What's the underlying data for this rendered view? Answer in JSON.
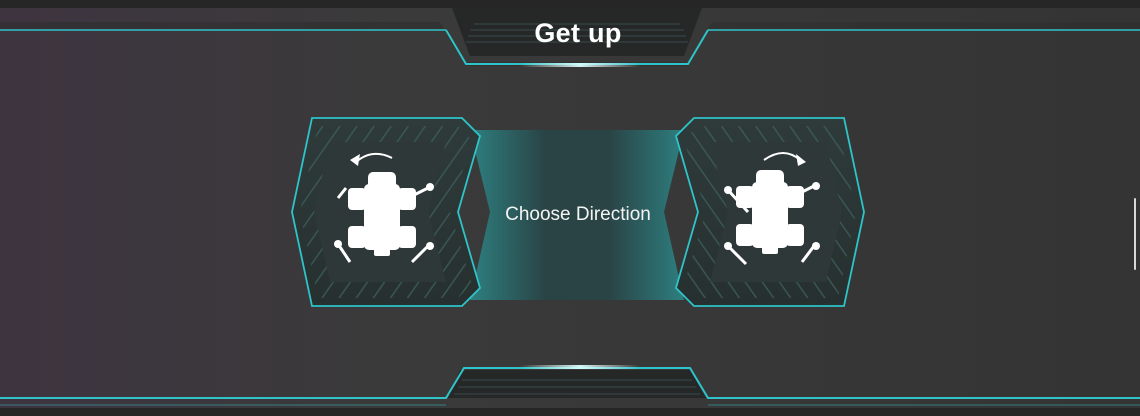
{
  "header": {
    "title": "Get up"
  },
  "main": {
    "center_label": "Choose Direction",
    "left_option": {
      "icon": "robot-rotate-counterclockwise-icon"
    },
    "right_option": {
      "icon": "robot-rotate-clockwise-icon"
    }
  },
  "colors": {
    "accent": "#2ec4c9",
    "background": "#363636",
    "panel": "#2e3a3a",
    "text": "#ffffff"
  }
}
